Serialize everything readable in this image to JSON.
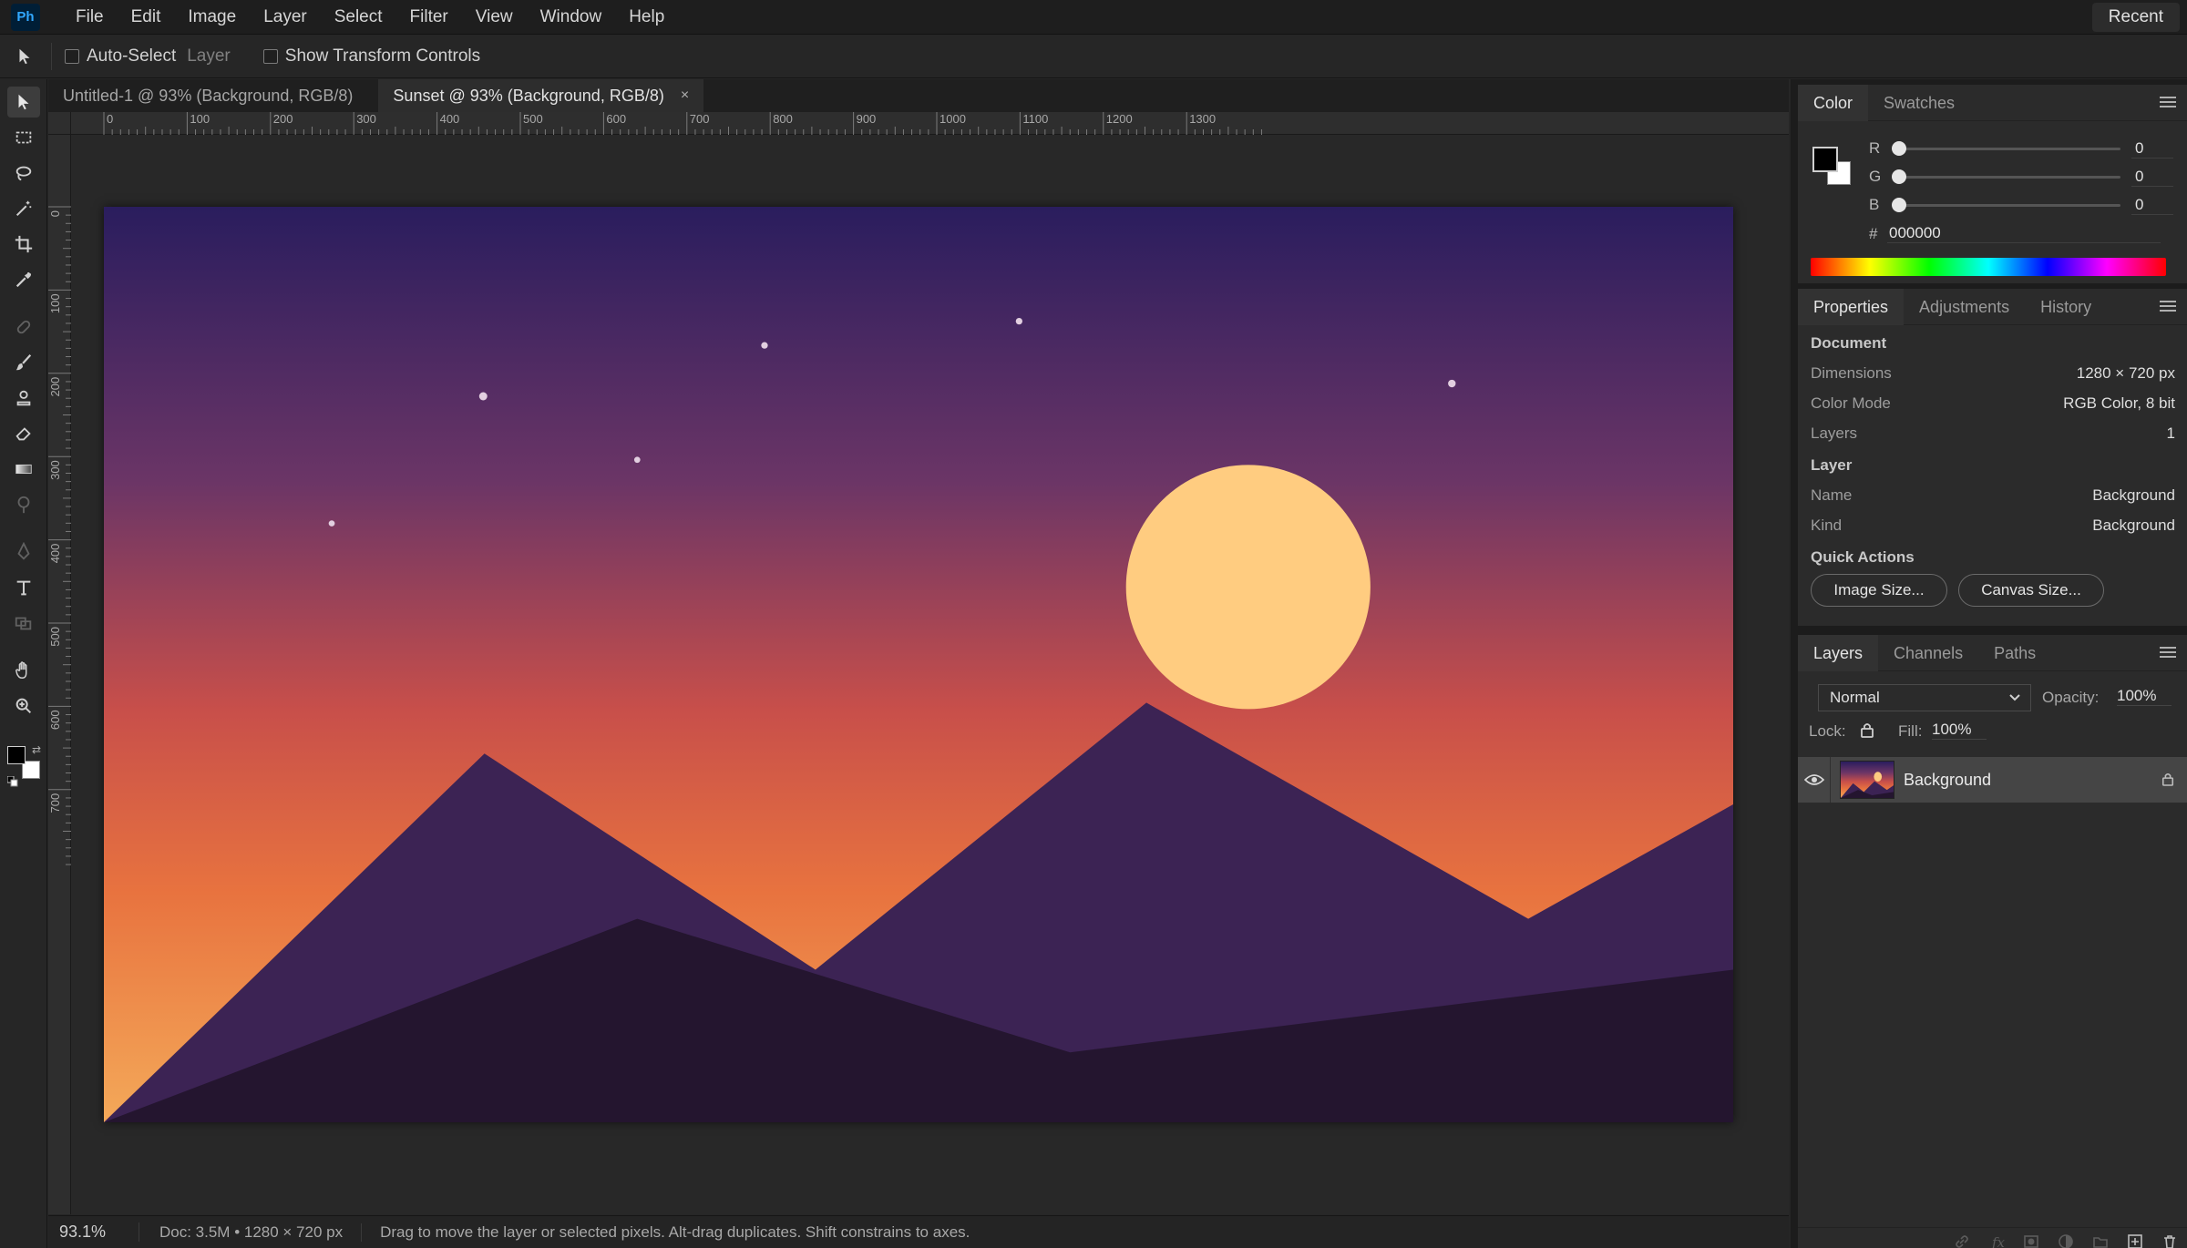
{
  "app": {
    "logo_text": "Ph",
    "brand_color": "#31a8ff"
  },
  "menu": [
    "File",
    "Edit",
    "Image",
    "Layer",
    "Select",
    "Filter",
    "View",
    "Window",
    "Help"
  ],
  "recent_label": "Recent",
  "options": {
    "auto_select_label": "Auto-Select",
    "auto_select_target": "Layer",
    "transform_controls_label": "Show Transform Controls"
  },
  "tabs": [
    {
      "label": "Untitled-1 @ 93% (Background, RGB/8)",
      "active": false
    },
    {
      "label": "Sunset @ 93% (Background, RGB/8)",
      "active": true,
      "close": "×"
    }
  ],
  "rulers": {
    "horizontal": [
      "0",
      "100",
      "200",
      "300",
      "400",
      "500",
      "600",
      "700",
      "800",
      "900",
      "1000",
      "1100",
      "1200",
      "1300"
    ],
    "vertical": [
      "0",
      "100",
      "200",
      "300",
      "400",
      "500",
      "600",
      "700"
    ]
  },
  "status": {
    "zoom": "93.1%",
    "doc": "Doc: 3.5M • 1280 × 720 px",
    "hint": "Drag to move the layer or selected pixels. Alt-drag duplicates. Shift constrains to axes."
  },
  "color_panel": {
    "tabs": [
      "Color",
      "Swatches"
    ],
    "r_label": "R",
    "r_value": "0",
    "g_label": "G",
    "g_value": "0",
    "b_label": "B",
    "b_value": "0",
    "hex_label": "#",
    "hex_value": "000000",
    "foreground": "#000000",
    "background": "#ffffff"
  },
  "properties_panel": {
    "tabs": [
      "Properties",
      "Adjustments",
      "History"
    ],
    "document_heading": "Document",
    "dimensions_label": "Dimensions",
    "dimensions_value": "1280 × 720 px",
    "color_mode_label": "Color Mode",
    "color_mode_value": "RGB Color, 8 bit",
    "layers_label": "Layers",
    "layers_value": "1",
    "layer_heading": "Layer",
    "name_label": "Name",
    "name_value": "Background",
    "kind_label": "Kind",
    "kind_value": "Background",
    "quick_actions_heading": "Quick Actions",
    "image_size_button": "Image Size...",
    "canvas_size_button": "Canvas Size..."
  },
  "layers_panel": {
    "tabs": [
      "Layers",
      "Channels",
      "Paths"
    ],
    "blend_mode": "Normal",
    "opacity_label": "Opacity:",
    "opacity_value": "100%",
    "lock_label": "Lock:",
    "fill_label": "Fill:",
    "fill_value": "100%",
    "layer_name": "Background"
  },
  "artwork": {
    "sky_colors": [
      "#2a1d5e",
      "#6b3566",
      "#c84f4a",
      "#e8733f",
      "#f4a959"
    ],
    "sun_color": "#ffcc80",
    "mountain_color": "#3c2354",
    "foreground_hill_color": "#24152f"
  }
}
